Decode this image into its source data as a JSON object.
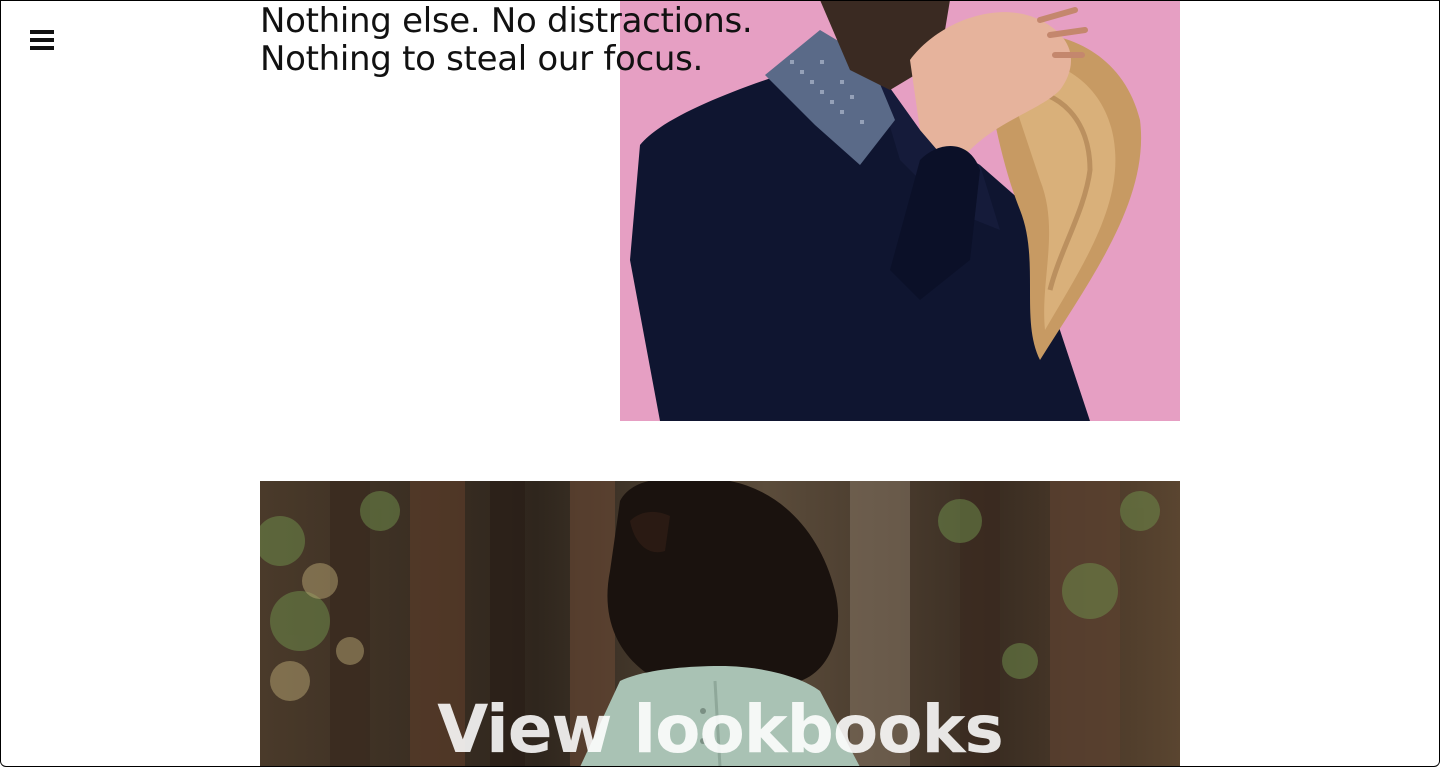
{
  "nav": {
    "menu_icon": "hamburger-menu-icon"
  },
  "intro": {
    "line1": "Nothing else. No distractions.",
    "line2": "Nothing to steal our focus."
  },
  "lookbooks": {
    "label": "View lookbooks"
  },
  "colors": {
    "pink_background": "#e59bc1",
    "sweater_navy": "#0f1530",
    "forest_dark": "#3d3226",
    "text_dark": "#111111",
    "overlay_text": "#ffffff"
  }
}
